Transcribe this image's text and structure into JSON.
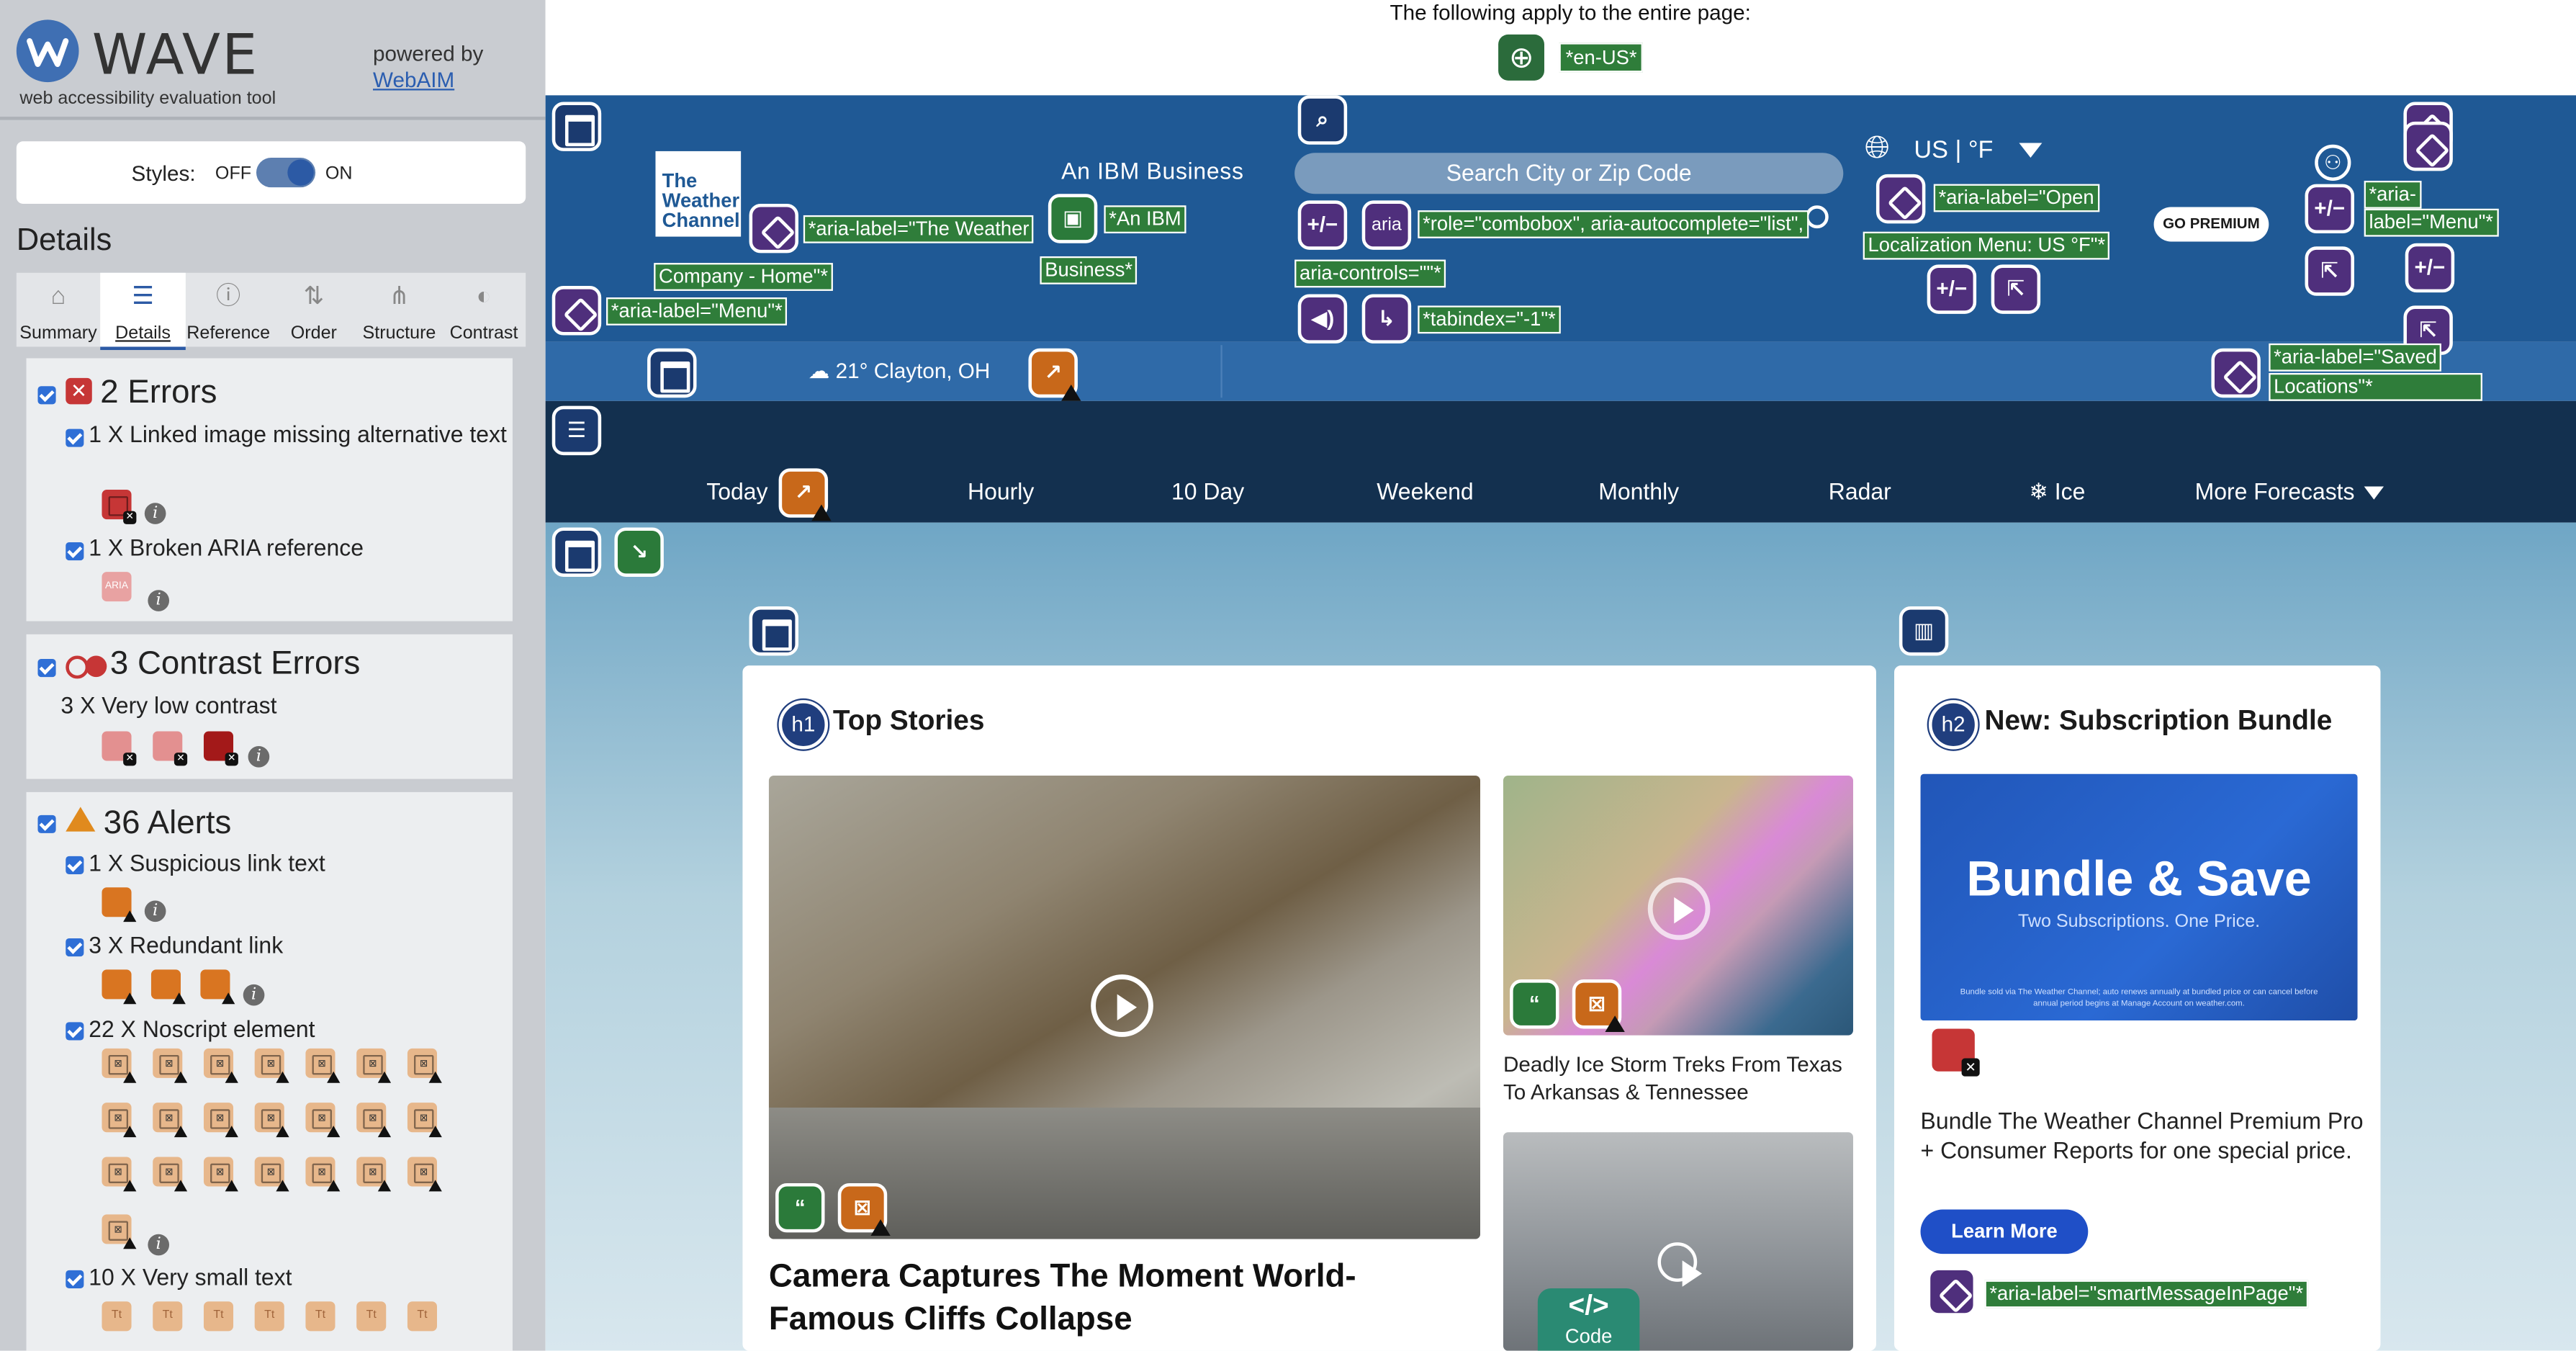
{
  "wave": {
    "title": "WAVE",
    "subtitle": "web accessibility evaluation tool",
    "powered_by": "powered by",
    "webaim_link": "WebAIM",
    "styles_label": "Styles:",
    "styles_off": "OFF",
    "styles_on": "ON",
    "details_heading": "Details",
    "tabs": [
      {
        "label": "Summary",
        "icon": "home-icon"
      },
      {
        "label": "Details",
        "icon": "list-icon",
        "active": true
      },
      {
        "label": "Reference",
        "icon": "info-icon"
      },
      {
        "label": "Order",
        "icon": "order-icon"
      },
      {
        "label": "Structure",
        "icon": "structure-icon"
      },
      {
        "label": "Contrast",
        "icon": "contrast-icon"
      }
    ],
    "errors": {
      "title": "2 Errors",
      "items": [
        "1 X Linked image missing alternative text",
        "1 X Broken ARIA reference"
      ]
    },
    "contrast": {
      "title": "3 Contrast Errors",
      "items": [
        "3 X Very low contrast"
      ]
    },
    "alerts": {
      "title": "36 Alerts",
      "items": [
        "1 X Suspicious link text",
        "3 X Redundant link",
        "22 X Noscript element",
        "10 X Very small text"
      ]
    },
    "aria_icon_text": "ARIA",
    "small_text_icon": "Tt"
  },
  "page": {
    "apply_text": "The following apply to the entire page:",
    "lang_tag": "*en-US*",
    "logo_text": "The Weather Channel",
    "ibm_text": "An IBM Business",
    "search_placeholder": "Search City or Zip Code",
    "units": "US | °F",
    "premium": "GO PREMIUM",
    "current_weather": "21° Clayton, OH",
    "nav": [
      "Today",
      "Hourly",
      "10 Day",
      "Weekend",
      "Monthly",
      "Radar",
      "Ice",
      "More Forecasts"
    ],
    "annotations": {
      "weather_label_1": "*aria-label=\"The Weather",
      "weather_label_2": "Company - Home\"*",
      "ibm_label_1": "*An IBM",
      "ibm_label_2": "Business*",
      "menu_label": "*aria-label=\"Menu\"*",
      "aria_badge": "aria",
      "role_label": "*role=\"combobox\", aria-autocomplete=\"list\",",
      "controls_label": "aria-controls=\"\"*",
      "tabindex_label": "*tabindex=\"-1\"*",
      "loc_label_1": "*aria-label=\"Open",
      "loc_label_2": "Localization Menu: US °F\"*",
      "menu_label_right_1": "*aria-",
      "menu_label_right_2": "label=\"Menu\"*",
      "saved_label_1": "*aria-label=\"Saved",
      "saved_label_2": "Locations\"*",
      "smart_label": "*aria-label=\"smartMessageInPage\"*",
      "h1": "h1",
      "h2": "h2"
    },
    "top_stories": "Top Stories",
    "subscription": "New: Subscription Bundle",
    "main_story": "Camera Captures The Moment World-Famous Cliffs Collapse",
    "side_story": "Deadly Ice Storm Treks From Texas To Arkansas & Tennessee",
    "code_badge_symbol": "</>",
    "code_badge": "Code",
    "bundle_title": "Bundle & Save",
    "bundle_sub": "Two Subscriptions. One Price.",
    "bundle_fine": "Bundle sold via The Weather Channel; auto renews annually at bundled price or can cancel before annual period begins at Manage Account on weather.com.",
    "bundle_text": "Bundle The Weather Channel Premium Pro + Consumer Reports for one special price.",
    "learn_more": "Learn More"
  }
}
